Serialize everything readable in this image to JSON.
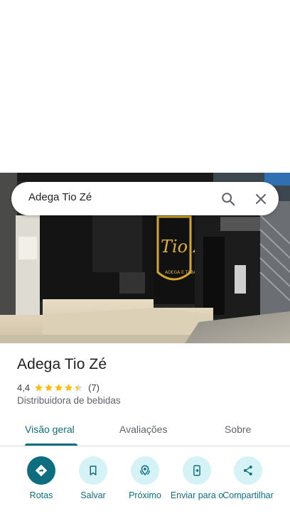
{
  "search": {
    "query": "Adega Tio Zé"
  },
  "photo": {
    "sign_text_1": "Tio Zé",
    "sign_text_2": "ADEGA E TABA"
  },
  "place": {
    "name": "Adega Tio Zé",
    "rating": "4,4",
    "rating_value": 4.4,
    "review_count": "(7)",
    "category": "Distribuidora de bebidas"
  },
  "tabs": [
    {
      "label": "Visão geral",
      "active": true
    },
    {
      "label": "Avaliações",
      "active": false
    },
    {
      "label": "Sobre",
      "active": false
    }
  ],
  "actions": [
    {
      "label": "Rotas",
      "icon": "directions-icon"
    },
    {
      "label": "Salvar",
      "icon": "bookmark-icon"
    },
    {
      "label": "Próximo",
      "icon": "nearby-icon"
    },
    {
      "label": "Enviar para o",
      "icon": "send-to-phone-icon"
    },
    {
      "label": "Compartilhar",
      "icon": "share-icon"
    }
  ],
  "colors": {
    "accent": "#0e6e7f",
    "action_bg": "#d5f2f7",
    "star": "#fbbc04"
  }
}
